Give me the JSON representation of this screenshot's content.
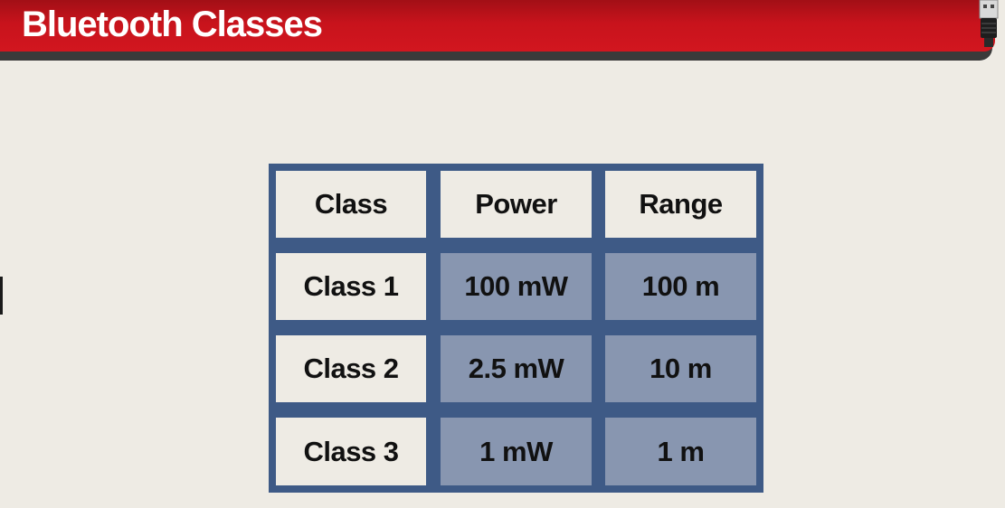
{
  "header": {
    "title": "Bluetooth Classes",
    "corner_icon": "usb-connector-icon"
  },
  "table": {
    "columns": [
      "Class",
      "Power",
      "Range"
    ],
    "rows": [
      [
        "Class 1",
        "100 mW",
        "100 m"
      ],
      [
        "Class 2",
        "2.5 mW",
        "10 m"
      ],
      [
        "Class 3",
        "1 mW",
        "1 m"
      ]
    ]
  },
  "colors": {
    "title_red": "#c8131c",
    "table_border": "#3e5a86",
    "data_cell": "#8896b0",
    "label_cell": "#eeebe4",
    "background": "#eeebe4"
  }
}
